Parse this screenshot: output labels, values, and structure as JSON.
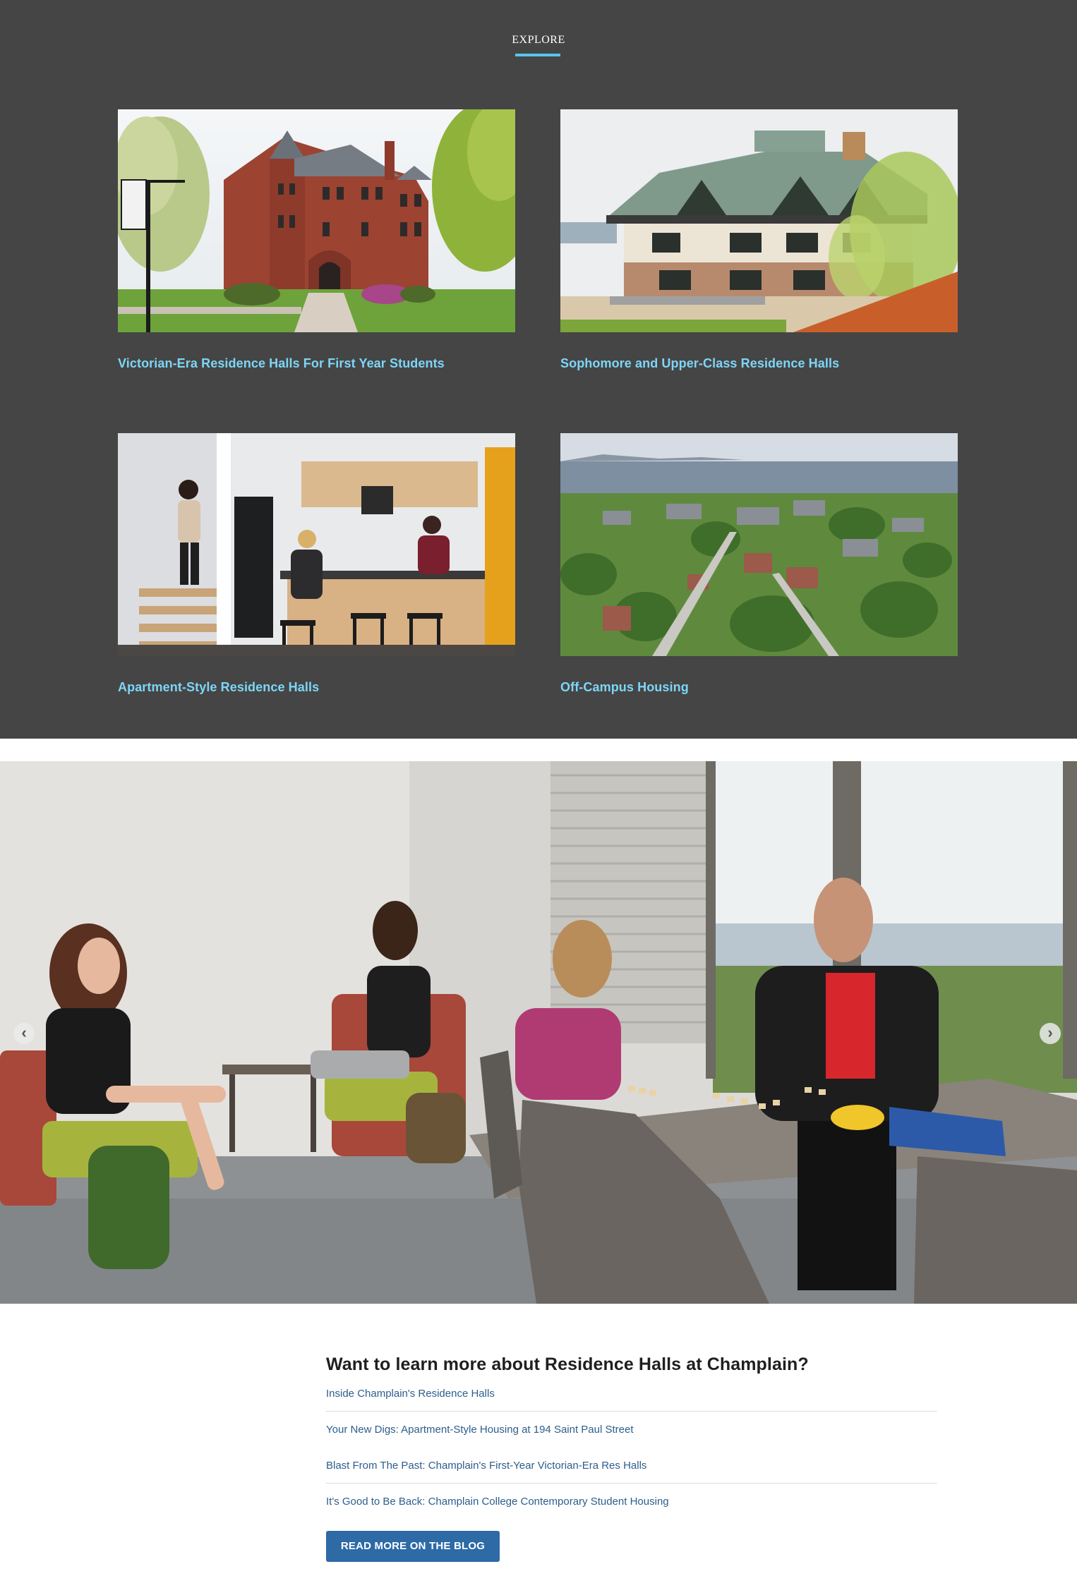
{
  "explore": {
    "heading": "EXPLORE",
    "accent_color": "#55c6f0",
    "cards": [
      {
        "title": "Victorian-Era Residence Halls For First Year Students",
        "image": "victorian-mansion-photo"
      },
      {
        "title": "Sophomore and Upper-Class Residence Halls",
        "image": "modern-residence-hall-photo"
      },
      {
        "title": "Apartment-Style Residence Halls",
        "image": "apartment-kitchen-photo"
      },
      {
        "title": "Off-Campus Housing",
        "image": "aerial-town-photo"
      }
    ]
  },
  "carousel": {
    "image": "students-lounge-scrabble-photo",
    "prev_icon": "chevron-left-icon",
    "next_icon": "chevron-right-icon",
    "prev_glyph": "‹",
    "next_glyph": "›"
  },
  "blog": {
    "title": "Want to learn more about Residence Halls at Champlain?",
    "links": [
      "Inside Champlain's Residence Halls",
      "Your New Digs: Apartment-Style Housing at 194 Saint Paul Street",
      "Blast From The Past: Champlain's First-Year Victorian-Era Res Halls",
      "It's Good to Be Back: Champlain College Contemporary Student Housing"
    ],
    "button_label": "READ MORE ON THE BLOG",
    "button_color": "#2d6aa6",
    "link_color": "#2c5e8c"
  }
}
